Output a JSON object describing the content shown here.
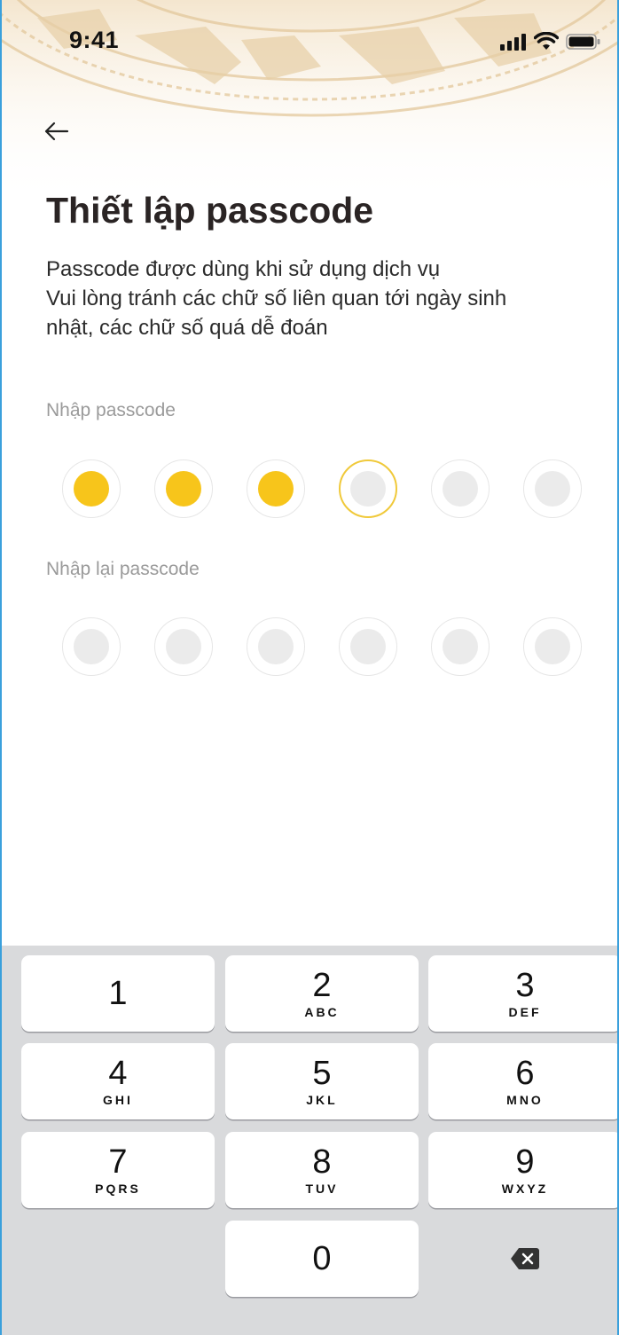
{
  "status_bar": {
    "time": "9:41"
  },
  "title": "Thiết lập passcode",
  "description": [
    "Passcode được dùng khi sử dụng dịch vụ",
    "Vui lòng tránh các chữ số liên quan tới ngày sinh",
    "nhật, các chữ số quá dễ đoán"
  ],
  "passcode": {
    "label": "Nhập passcode",
    "length": 6,
    "filled": 3
  },
  "confirm_passcode": {
    "label": "Nhập lại passcode",
    "length": 6,
    "filled": 0
  },
  "keypad": {
    "keys": [
      {
        "num": "1",
        "letters": ""
      },
      {
        "num": "2",
        "letters": "ABC"
      },
      {
        "num": "3",
        "letters": "DEF"
      },
      {
        "num": "4",
        "letters": "GHI"
      },
      {
        "num": "5",
        "letters": "JKL"
      },
      {
        "num": "6",
        "letters": "MNO"
      },
      {
        "num": "7",
        "letters": "PQRS"
      },
      {
        "num": "8",
        "letters": "TUV"
      },
      {
        "num": "9",
        "letters": "WXYZ"
      },
      {
        "num": "0",
        "letters": ""
      }
    ]
  },
  "colors": {
    "accent": "#f7c51b",
    "empty_dot": "#ebebeb",
    "keypad_bg": "#d9dadc"
  }
}
